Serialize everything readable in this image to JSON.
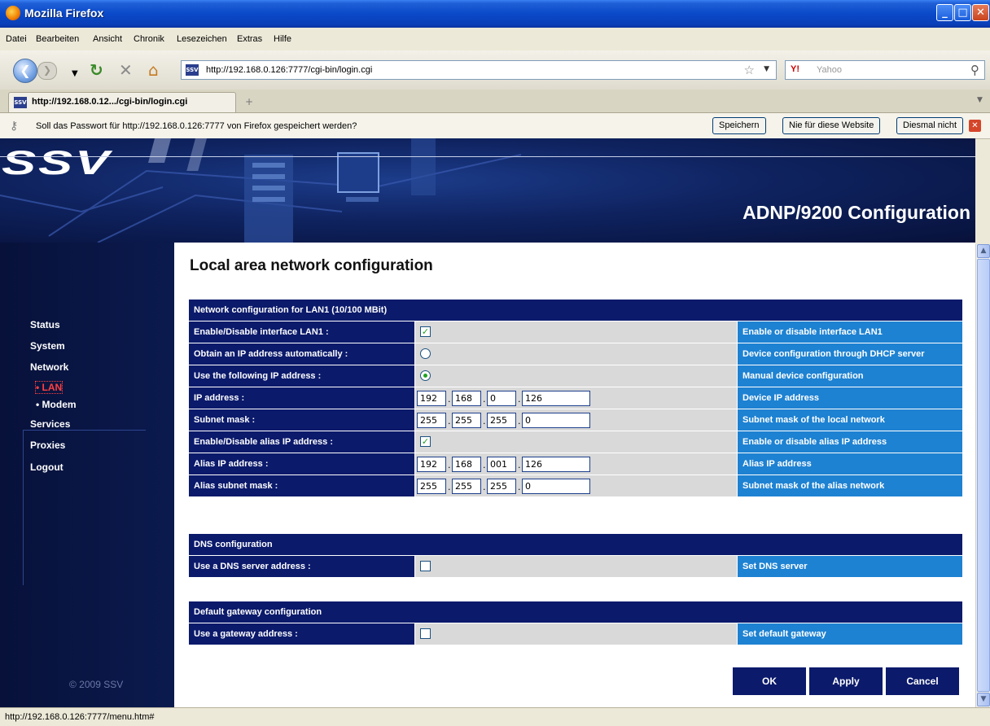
{
  "window": {
    "title": "Mozilla Firefox"
  },
  "menu": [
    "Datei",
    "Bearbeiten",
    "Ansicht",
    "Chronik",
    "Lesezeichen",
    "Extras",
    "Hilfe"
  ],
  "nav": {
    "url": "http://192.168.0.126:7777/cgi-bin/login.cgi",
    "search_placeholder": "Yahoo",
    "search_engine": "Y!"
  },
  "tab": {
    "title": "http://192.168.0.12.../cgi-bin/login.cgi",
    "favicon": "SSV"
  },
  "passwordbar": {
    "message": "Soll das Passwort für http://192.168.0.126:7777 von Firefox gespeichert werden?",
    "save": "Speichern",
    "never": "Nie für diese Website",
    "notnow": "Diesmal nicht"
  },
  "header": {
    "logo": "SSV",
    "title": "ADNP/9200 Configuration"
  },
  "sidebar": {
    "items": [
      "Status",
      "System",
      "Network"
    ],
    "subitems": [
      "• LAN",
      "• Modem"
    ],
    "items2": [
      "Services",
      "Proxies",
      "Logout"
    ],
    "copyright": "© 2009 SSV"
  },
  "page": {
    "title": "Local area network configuration"
  },
  "lan": {
    "header": "Network configuration for LAN1 (10/100 MBit)",
    "rows": [
      {
        "label": "Enable/Disable interface LAN1 :",
        "desc": "Enable or disable interface LAN1"
      },
      {
        "label": "Obtain an IP address automatically :",
        "desc": "Device configuration through DHCP server"
      },
      {
        "label": "Use the following IP address :",
        "desc": "Manual device configuration"
      },
      {
        "label": "IP address :",
        "desc": "Device IP address",
        "ip": [
          "192",
          "168",
          "0",
          "126"
        ]
      },
      {
        "label": "Subnet mask :",
        "desc": "Subnet mask of the local network",
        "ip": [
          "255",
          "255",
          "255",
          "0"
        ]
      },
      {
        "label": "Enable/Disable alias IP address :",
        "desc": "Enable or disable alias IP address"
      },
      {
        "label": "Alias IP address :",
        "desc": "Alias IP address",
        "ip": [
          "192",
          "168",
          "001",
          "126"
        ]
      },
      {
        "label": "Alias subnet mask :",
        "desc": "Subnet mask of the alias network",
        "ip": [
          "255",
          "255",
          "255",
          "0"
        ]
      }
    ]
  },
  "dns": {
    "header": "DNS configuration",
    "label": "Use a DNS server address :",
    "desc": "Set DNS server"
  },
  "gateway": {
    "header": "Default gateway configuration",
    "label": "Use a gateway address :",
    "desc": "Set default gateway"
  },
  "buttons": {
    "ok": "OK",
    "apply": "Apply",
    "cancel": "Cancel"
  },
  "status": {
    "text": "http://192.168.0.126:7777/menu.htm#"
  },
  "colors": {
    "navy": "#0b1a6b",
    "blue": "#1e82d2",
    "grey": "#d9d9d9"
  }
}
